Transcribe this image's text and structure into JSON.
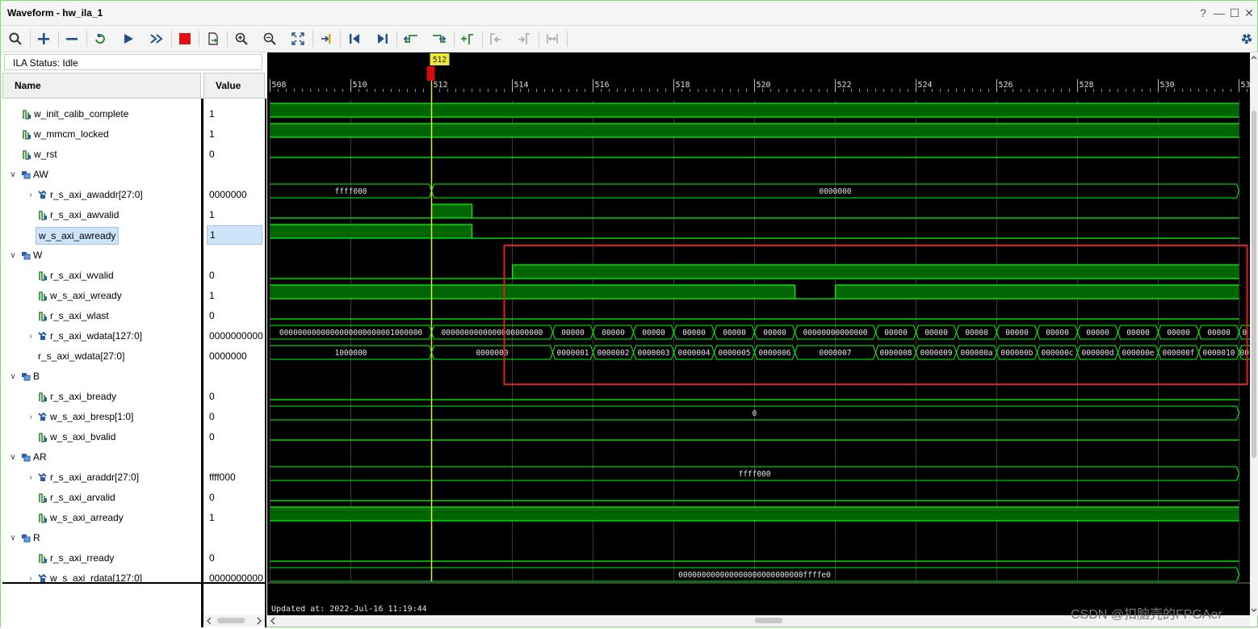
{
  "window": {
    "title": "Waveform - hw_ila_1",
    "help": "?",
    "minimize": "—",
    "maximize": "☐",
    "close": "✕"
  },
  "toolbar": {
    "icons": [
      "search-icon",
      "add-icon",
      "remove-icon",
      "refresh-icon",
      "run-trigger-icon",
      "run-continuous-icon",
      "stop-icon",
      "export-icon",
      "zoom-in-icon",
      "zoom-out-icon",
      "zoom-fit-icon",
      "go-to-cursor-icon",
      "go-to-start-icon",
      "go-to-end-icon",
      "previous-transition-icon",
      "next-transition-icon",
      "add-marker-icon",
      "previous-marker-icon",
      "next-marker-icon",
      "swap-cursors-icon",
      "settings-icon"
    ]
  },
  "status": {
    "text": "ILA Status: Idle"
  },
  "columns": {
    "name": "Name",
    "value": "Value"
  },
  "signals": [
    {
      "name": "w_init_calib_complete",
      "value": "1",
      "kind": "bit",
      "indent": 0
    },
    {
      "name": "w_mmcm_locked",
      "value": "1",
      "kind": "bit",
      "indent": 0
    },
    {
      "name": "w_rst",
      "value": "0",
      "kind": "bit",
      "indent": 0
    },
    {
      "name": "AW",
      "value": "",
      "kind": "group",
      "indent": 0
    },
    {
      "name": "r_s_axi_awaddr[27:0]",
      "value": "0000000",
      "kind": "bus",
      "indent": 1
    },
    {
      "name": "r_s_axi_awvalid",
      "value": "1",
      "kind": "bit",
      "indent": 1
    },
    {
      "name": "w_s_axi_awready",
      "value": "1",
      "kind": "bit",
      "indent": 1,
      "selected": true
    },
    {
      "name": "W",
      "value": "",
      "kind": "group",
      "indent": 0
    },
    {
      "name": "r_s_axi_wvalid",
      "value": "0",
      "kind": "bit",
      "indent": 1
    },
    {
      "name": "w_s_axi_wready",
      "value": "1",
      "kind": "bit",
      "indent": 1
    },
    {
      "name": "r_s_axi_wlast",
      "value": "0",
      "kind": "bit",
      "indent": 1
    },
    {
      "name": "r_s_axi_wdata[127:0]",
      "value": "0000000000",
      "kind": "bus",
      "indent": 1
    },
    {
      "name": "r_s_axi_wdata[27:0]",
      "value": "0000000",
      "kind": "virtual",
      "indent": 1
    },
    {
      "name": "B",
      "value": "",
      "kind": "group",
      "indent": 0
    },
    {
      "name": "r_s_axi_bready",
      "value": "0",
      "kind": "bit",
      "indent": 1
    },
    {
      "name": "w_s_axi_bresp[1:0]",
      "value": "0",
      "kind": "bus",
      "indent": 1
    },
    {
      "name": "w_s_axi_bvalid",
      "value": "0",
      "kind": "bit",
      "indent": 1
    },
    {
      "name": "AR",
      "value": "",
      "kind": "group",
      "indent": 0
    },
    {
      "name": "r_s_axi_araddr[27:0]",
      "value": "ffff000",
      "kind": "bus",
      "indent": 1
    },
    {
      "name": "r_s_axi_arvalid",
      "value": "0",
      "kind": "bit",
      "indent": 1
    },
    {
      "name": "w_s_axi_arready",
      "value": "1",
      "kind": "bit",
      "indent": 1
    },
    {
      "name": "R",
      "value": "",
      "kind": "group",
      "indent": 0
    },
    {
      "name": "r_s_axi_rready",
      "value": "0",
      "kind": "bit",
      "indent": 1
    },
    {
      "name": "w_s_axi_rdata[127:0]",
      "value": "0000000000",
      "kind": "bus",
      "indent": 1
    }
  ],
  "waveform": {
    "sample_start": 508,
    "sample_end": 532,
    "axis_ticks": [
      "508",
      "510",
      "512",
      "514",
      "516",
      "518",
      "520",
      "522",
      "524",
      "526",
      "528",
      "530",
      "53"
    ],
    "cursor": {
      "sample": 512,
      "label": "512"
    },
    "tracks": [
      {
        "type": "bit",
        "segments": [
          [
            508,
            532,
            1
          ]
        ]
      },
      {
        "type": "bit",
        "segments": [
          [
            508,
            532,
            1
          ]
        ]
      },
      {
        "type": "bit",
        "segments": [
          [
            508,
            532,
            0
          ]
        ]
      },
      {
        "type": "empty"
      },
      {
        "type": "bus",
        "segments": [
          [
            508,
            512,
            "ffff000"
          ],
          [
            512,
            532,
            "0000000"
          ]
        ]
      },
      {
        "type": "bit",
        "segments": [
          [
            508,
            512,
            0
          ],
          [
            512,
            513,
            1
          ],
          [
            513,
            532,
            0
          ]
        ]
      },
      {
        "type": "bit",
        "segments": [
          [
            508,
            513,
            1
          ],
          [
            513,
            532,
            0
          ]
        ]
      },
      {
        "type": "empty"
      },
      {
        "type": "bit",
        "segments": [
          [
            508,
            514,
            0
          ],
          [
            514,
            532,
            1
          ]
        ]
      },
      {
        "type": "bit",
        "segments": [
          [
            508,
            521,
            1
          ],
          [
            521,
            522,
            0
          ],
          [
            522,
            532,
            1
          ]
        ]
      },
      {
        "type": "bit",
        "segments": [
          [
            508,
            532,
            0
          ]
        ]
      },
      {
        "type": "bus",
        "segments": [
          [
            508,
            512,
            "0000000000000000000000001000000"
          ],
          [
            512,
            515,
            "0000000000000000000000"
          ],
          [
            515,
            516,
            "00000"
          ],
          [
            516,
            517,
            "00000"
          ],
          [
            517,
            518,
            "00000"
          ],
          [
            518,
            519,
            "00000"
          ],
          [
            519,
            520,
            "00000"
          ],
          [
            520,
            521,
            "00000"
          ],
          [
            521,
            523,
            "00000000000000"
          ],
          [
            523,
            524,
            "00000"
          ],
          [
            524,
            525,
            "00000"
          ],
          [
            525,
            526,
            "00000"
          ],
          [
            526,
            527,
            "00000"
          ],
          [
            527,
            528,
            "00000"
          ],
          [
            528,
            529,
            "00000"
          ],
          [
            529,
            530,
            "00000"
          ],
          [
            530,
            531,
            "00000"
          ],
          [
            531,
            532,
            "00000"
          ],
          [
            532,
            533,
            "0"
          ]
        ]
      },
      {
        "type": "bus",
        "segments": [
          [
            508,
            512,
            "1000000"
          ],
          [
            512,
            515,
            "0000000"
          ],
          [
            515,
            516,
            "0000001"
          ],
          [
            516,
            517,
            "0000002"
          ],
          [
            517,
            518,
            "0000003"
          ],
          [
            518,
            519,
            "0000004"
          ],
          [
            519,
            520,
            "0000005"
          ],
          [
            520,
            521,
            "0000006"
          ],
          [
            521,
            523,
            "0000007"
          ],
          [
            523,
            524,
            "0000008"
          ],
          [
            524,
            525,
            "0000009"
          ],
          [
            525,
            526,
            "000000a"
          ],
          [
            526,
            527,
            "000000b"
          ],
          [
            527,
            528,
            "000000c"
          ],
          [
            528,
            529,
            "000000d"
          ],
          [
            529,
            530,
            "000000e"
          ],
          [
            530,
            531,
            "000000f"
          ],
          [
            531,
            532,
            "0000010"
          ],
          [
            532,
            533,
            "00"
          ]
        ]
      },
      {
        "type": "empty"
      },
      {
        "type": "bit",
        "segments": [
          [
            508,
            532,
            0
          ]
        ]
      },
      {
        "type": "bus",
        "segments": [
          [
            508,
            532,
            "0"
          ]
        ]
      },
      {
        "type": "bit",
        "segments": [
          [
            508,
            532,
            0
          ]
        ]
      },
      {
        "type": "empty"
      },
      {
        "type": "bus",
        "segments": [
          [
            508,
            532,
            "ffff000"
          ]
        ]
      },
      {
        "type": "bit",
        "segments": [
          [
            508,
            532,
            0
          ]
        ]
      },
      {
        "type": "bit",
        "segments": [
          [
            508,
            532,
            1
          ]
        ]
      },
      {
        "type": "empty"
      },
      {
        "type": "bit",
        "segments": [
          [
            508,
            532,
            0
          ]
        ]
      },
      {
        "type": "bus",
        "segments": [
          [
            508,
            532,
            "000000000000000000000000000ffffe0"
          ]
        ]
      }
    ],
    "highlight": {
      "from_sample": 513.8,
      "to_sample": 532.2,
      "from_track": 8,
      "to_track": 14,
      "color": "#e02020"
    },
    "updated_text": "Updated at: 2022-Jul-16 11:19:44"
  },
  "colors": {
    "wave_high": "#00ff00",
    "wave_fill": "#006400",
    "cursor": "#e8e83a",
    "grid": "#3a3a3a"
  },
  "watermark": "CSDN @扣脑壳的FPGAer"
}
